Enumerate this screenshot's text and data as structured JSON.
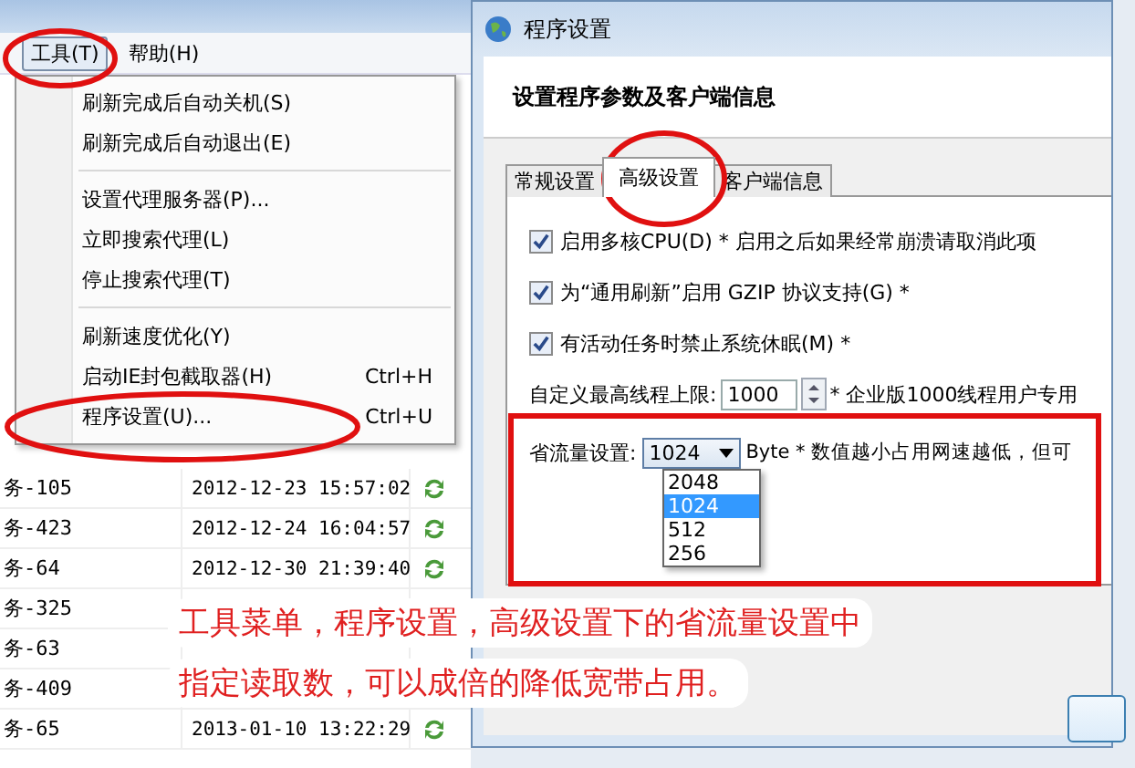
{
  "app_window": {
    "menu_bar": [
      {
        "label": "工具(T)",
        "selected": true
      },
      {
        "label": "帮助(H)",
        "selected": false
      }
    ],
    "tools_menu": [
      [
        {
          "label": "刷新完成后自动关机(S)"
        },
        {
          "label": "刷新完成后自动退出(E)"
        }
      ],
      [
        {
          "label": "设置代理服务器(P)..."
        },
        {
          "label": "立即搜索代理(L)"
        },
        {
          "label": "停止搜索代理(T)"
        }
      ],
      [
        {
          "label": "刷新速度优化(Y)"
        },
        {
          "label": "启动IE封包截取器(H)",
          "shortcut": "Ctrl+H"
        },
        {
          "label": "程序设置(U)...",
          "shortcut": "Ctrl+U"
        }
      ]
    ],
    "task_rows": [
      {
        "name": "务-105",
        "time": "2012-12-23 15:57:02"
      },
      {
        "name": "务-423",
        "time": "2012-12-24 16:04:57"
      },
      {
        "name": "务-64",
        "time": "2012-12-30 21:39:40"
      },
      {
        "name": "务-325"
      },
      {
        "name": "务-63"
      },
      {
        "name": "务-409"
      },
      {
        "name": "务-65",
        "time": "2013-01-10 13:22:29"
      }
    ]
  },
  "settings_dialog": {
    "title": "程序设置",
    "heading": "设置程序参数及客户端信息",
    "tabs": [
      {
        "label": "常规设置",
        "selected": false
      },
      {
        "label": "高级设置",
        "selected": true
      },
      {
        "label": "客户端信息",
        "selected": false
      }
    ],
    "options": [
      {
        "label": "启用多核CPU(D) * 启用之后如果经常崩溃请取消此项",
        "checked": true
      },
      {
        "label": "为“通用刷新”启用 GZIP 协议支持(G) *",
        "checked": true
      },
      {
        "label": "有活动任务时禁止系统休眠(M) *",
        "checked": true
      }
    ],
    "thread_limit": {
      "label": "自定义最高线程上限:",
      "value": "1000",
      "note": "* 企业版1000线程用户专用"
    },
    "traffic": {
      "label": "省流量设置:",
      "value": "1024",
      "note": "Byte * 数值越小占用网速越低，但可",
      "options": [
        {
          "label": "2048",
          "selected": false
        },
        {
          "label": "1024",
          "selected": true
        },
        {
          "label": "512",
          "selected": false
        },
        {
          "label": "256",
          "selected": false
        }
      ]
    }
  },
  "annotation": {
    "lines": [
      "工具菜单，程序设置，高级设置下的省流量设置中",
      "指定读取数，可以成倍的降低宽带占用。"
    ]
  }
}
